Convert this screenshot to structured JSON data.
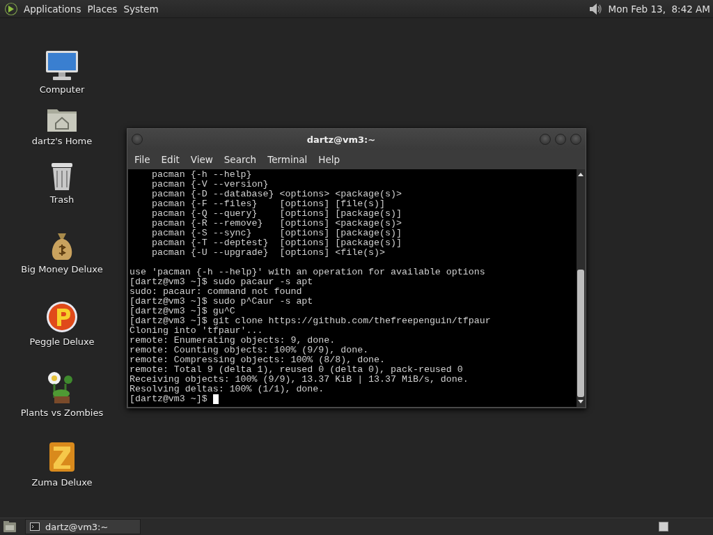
{
  "top_panel": {
    "menus": [
      "Applications",
      "Places",
      "System"
    ],
    "clock": "Mon Feb 13,  8:42 AM"
  },
  "desktop_icons": [
    {
      "label": "Computer",
      "kind": "computer"
    },
    {
      "label": "dartz's Home",
      "kind": "home"
    },
    {
      "label": "Trash",
      "kind": "trash"
    },
    {
      "label": "Big Money Deluxe",
      "kind": "money"
    },
    {
      "label": "Peggle Deluxe",
      "kind": "peggle"
    },
    {
      "label": "Plants vs Zombies",
      "kind": "plant"
    },
    {
      "label": "Zuma Deluxe",
      "kind": "zuma"
    }
  ],
  "terminal": {
    "title": "dartz@vm3:~",
    "menu": [
      "File",
      "Edit",
      "View",
      "Search",
      "Terminal",
      "Help"
    ],
    "usage_lines": [
      {
        "text": "    pacman {-h --help}"
      },
      {
        "text": "    pacman {-V --version}"
      },
      {
        "text": "    pacman {-D --database} <options> <package(s)>"
      },
      {
        "text": "    pacman {-F --files}    [options] [file(s)]"
      },
      {
        "text": "    pacman {-Q --query}    [options] [package(s)]"
      },
      {
        "text": "    pacman {-R --remove}   [options] <package(s)>"
      },
      {
        "text": "    pacman {-S --sync}     [options] [package(s)]"
      },
      {
        "text": "    pacman {-T --deptest}  [options] [package(s)]"
      },
      {
        "text": "    pacman {-U --upgrade}  [options] <file(s)>"
      }
    ],
    "session_lines": [
      {
        "text": "use 'pacman {-h --help}' with an operation for available options"
      },
      {
        "text": "[dartz@vm3 ~]$ sudo pacaur -s apt"
      },
      {
        "text": "sudo: pacaur: command not found"
      },
      {
        "text": "[dartz@vm3 ~]$ sudo p^Caur -s apt"
      },
      {
        "text": "[dartz@vm3 ~]$ gu^C"
      },
      {
        "text": "[dartz@vm3 ~]$ git clone https://github.com/thefreepenguin/tfpaur"
      },
      {
        "text": "Cloning into 'tfpaur'..."
      },
      {
        "text": "remote: Enumerating objects: 9, done."
      },
      {
        "text": "remote: Counting objects: 100% (9/9), done."
      },
      {
        "text": "remote: Compressing objects: 100% (8/8), done."
      },
      {
        "text": "remote: Total 9 (delta 1), reused 0 (delta 0), pack-reused 0"
      },
      {
        "text": "Receiving objects: 100% (9/9), 13.37 KiB | 13.37 MiB/s, done."
      },
      {
        "text": "Resolving deltas: 100% (1/1), done."
      },
      {
        "text": "[dartz@vm3 ~]$ ",
        "cursor": true
      }
    ]
  },
  "bottom_panel": {
    "tasks": [
      {
        "label": "dartz@vm3:~",
        "selected": false
      }
    ]
  }
}
